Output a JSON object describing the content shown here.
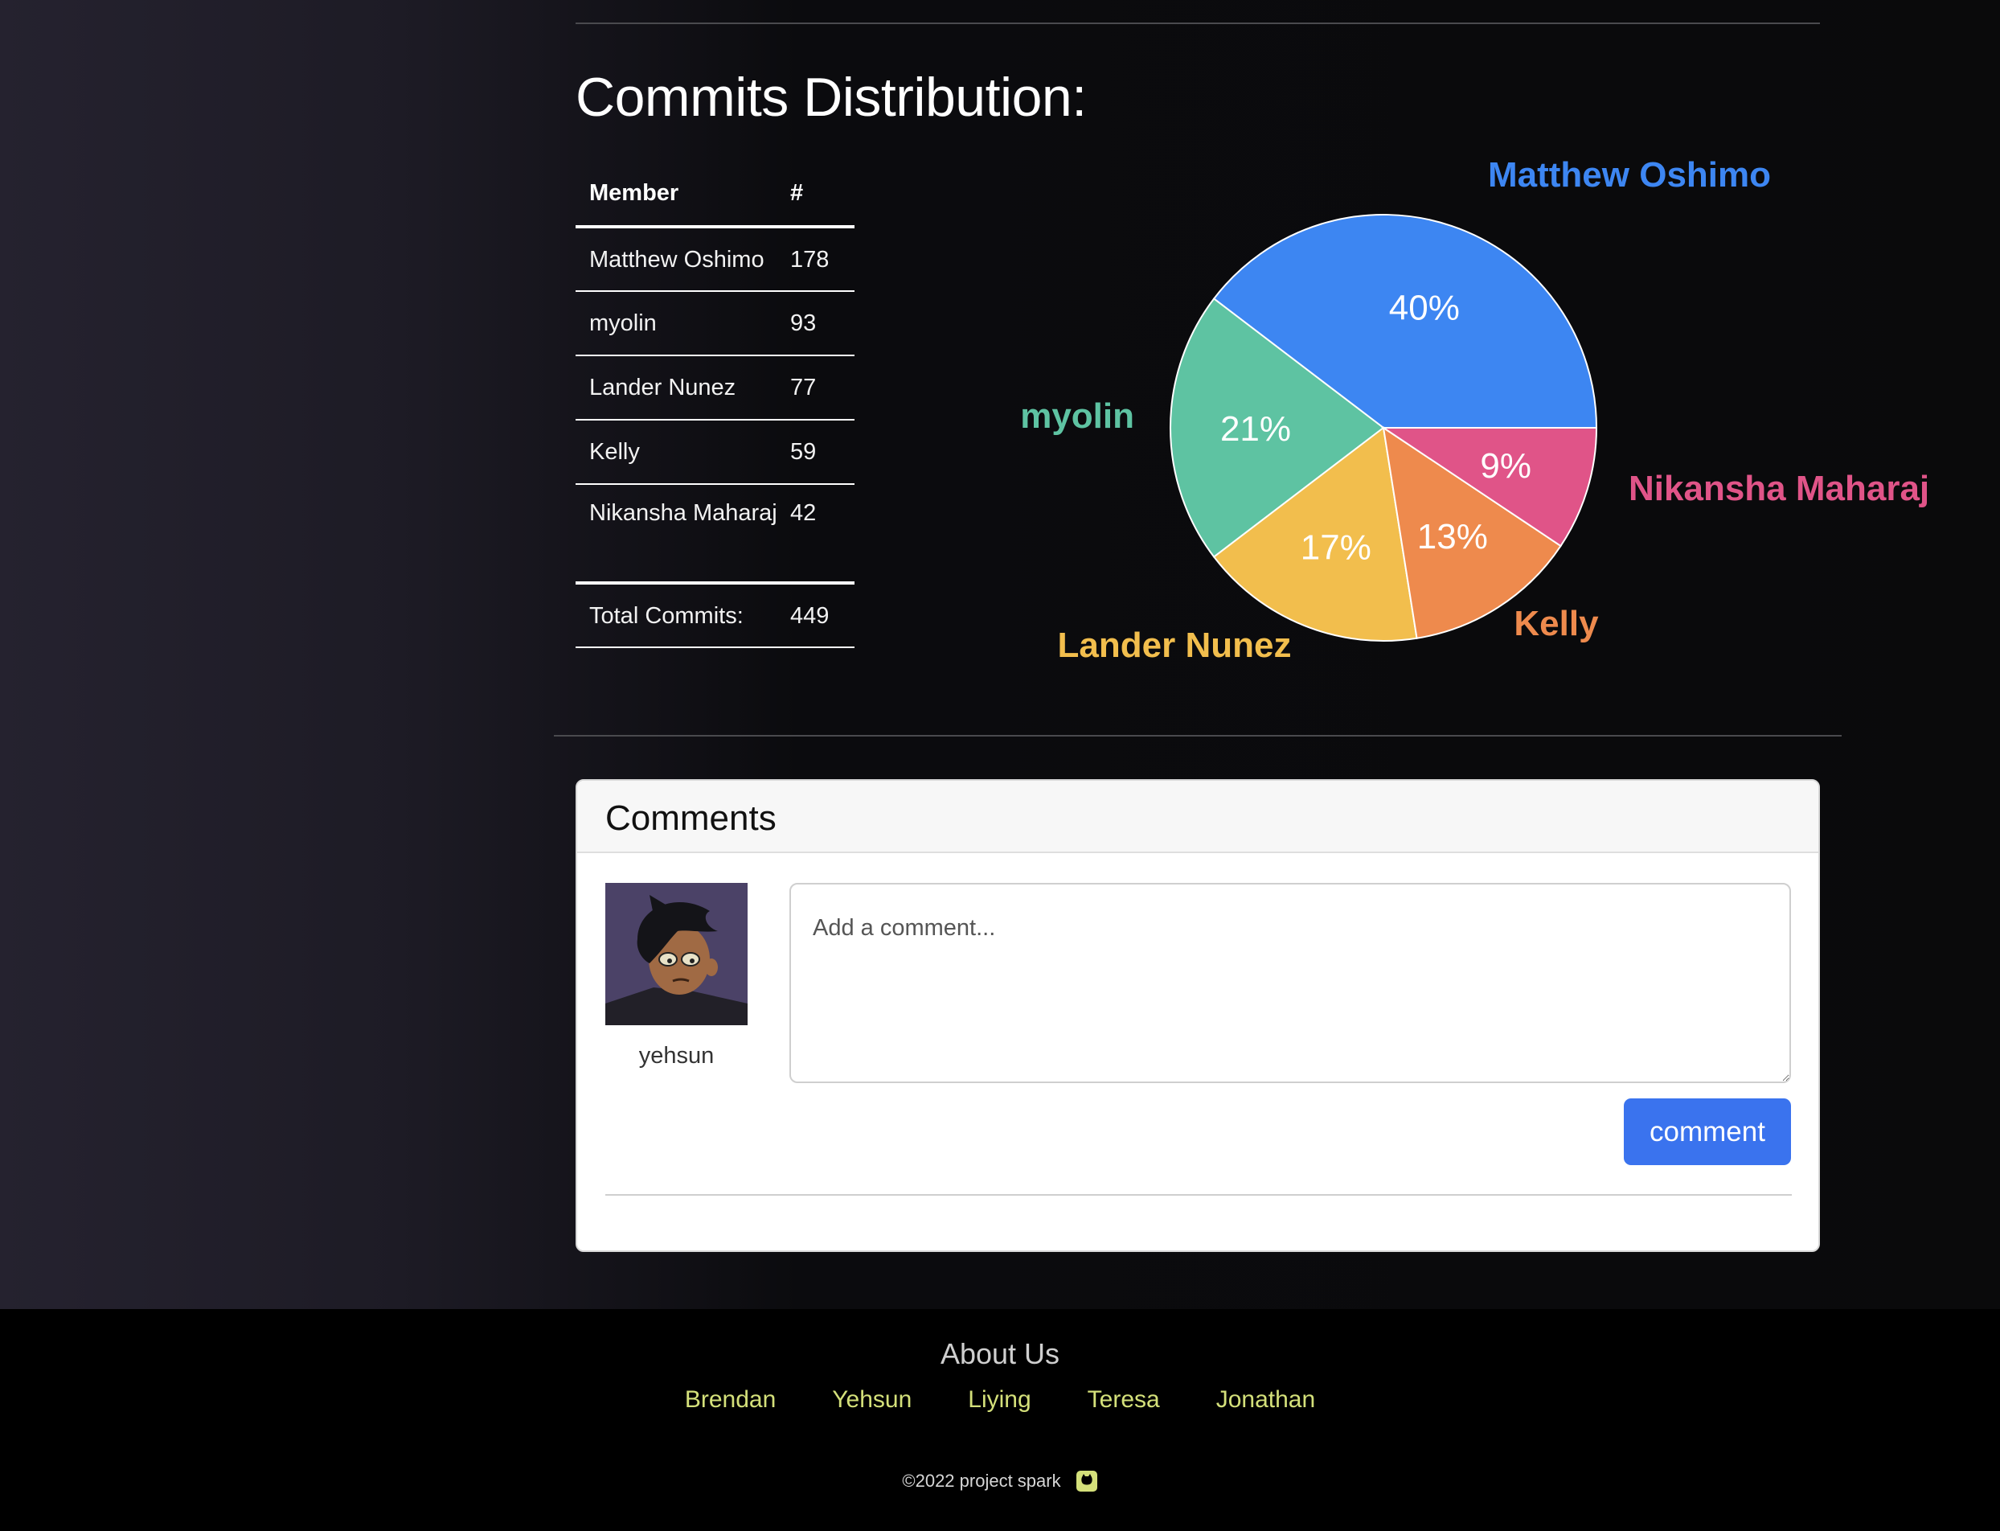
{
  "section_title": "Commits Distribution:",
  "table": {
    "headers": [
      "Member",
      "#"
    ],
    "rows": [
      {
        "member": "Matthew Oshimo",
        "count": "178"
      },
      {
        "member": "myolin",
        "count": "93"
      },
      {
        "member": "Lander Nunez",
        "count": "77"
      },
      {
        "member": "Kelly",
        "count": "59"
      },
      {
        "member": "Nikansha Maharaj",
        "count": "42"
      }
    ],
    "total_label": "Total Commits:",
    "total_value": "449"
  },
  "chart_data": {
    "type": "pie",
    "title": "",
    "categories": [
      "Matthew Oshimo",
      "myolin",
      "Lander Nunez",
      "Kelly",
      "Nikansha Maharaj"
    ],
    "values": [
      178,
      93,
      77,
      59,
      42
    ],
    "percent_labels": [
      "40%",
      "21%",
      "17%",
      "13%",
      "9%"
    ],
    "colors": [
      "#3d86f2",
      "#5ec3a2",
      "#f2be4d",
      "#ee8a4d",
      "#e05488"
    ],
    "legend": "outside labels"
  },
  "comments": {
    "title": "Comments",
    "username": "yehsun",
    "placeholder": "Add a comment...",
    "button_label": "comment"
  },
  "footer": {
    "title": "About Us",
    "links": [
      "Brendan",
      "Yehsun",
      "Liying",
      "Teresa",
      "Jonathan"
    ],
    "copyright": "©2022 project spark",
    "icon": "github-icon"
  }
}
